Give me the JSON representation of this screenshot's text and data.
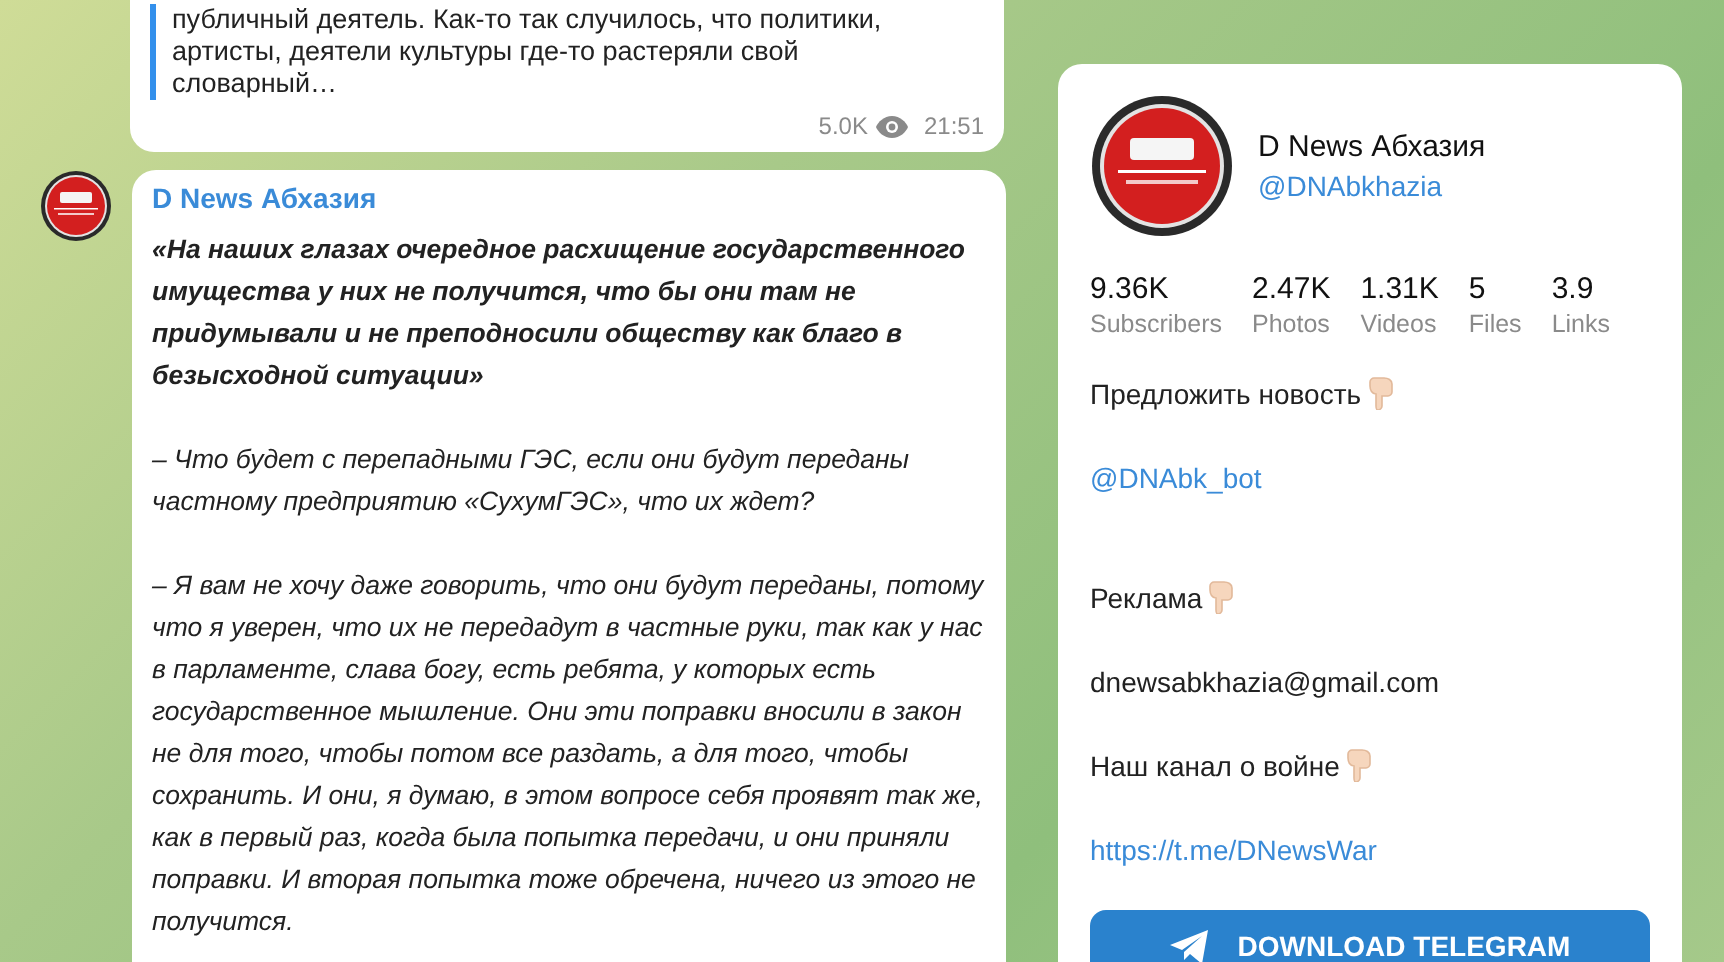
{
  "previous_post": {
    "quote_lines": "публичный деятель. Как-то так случилось, что политики, артисты, деятели культуры где-то растеряли свой словарный…",
    "views": "5.0K",
    "time": "21:51"
  },
  "post": {
    "author": "D News Абхазия",
    "paragraphs": [
      {
        "text": "«На наших глазах очередное расхищение государственного имущества у них не получится, что бы они там не придумывали и не преподносили обществу как благо в безысходной ситуации»",
        "bold": true
      },
      {
        "text": "– Что будет с перепадными ГЭС, если они будут переданы частному предприятию «СухумГЭС», что их ждет?",
        "bold": false
      },
      {
        "text": "– Я вам не хочу даже говорить, что они будут переданы, потому что я уверен, что их не передадут в частные руки, так как у нас в парламенте, слава богу, есть ребята, у которых есть государственное мышление. Они эти поправки вносили в закон не для того, чтобы потом все раздать, а для того, чтобы сохранить. И они, я думаю, в этом вопросе себя проявят так же, как в первый раз, когда была попытка передачи, и они приняли поправки. И вторая попытка тоже обречена, ничего из этого не получится.",
        "bold": false
      }
    ]
  },
  "channel": {
    "name": "D News Абхазия",
    "handle": "@DNAbkhazia",
    "stats": [
      {
        "value": "9.36K",
        "label": "Subscribers"
      },
      {
        "value": "2.47K",
        "label": "Photos"
      },
      {
        "value": "1.31K",
        "label": "Videos"
      },
      {
        "value": "5",
        "label": "Files"
      },
      {
        "value": "3.9",
        "label": "Links"
      }
    ],
    "description": [
      {
        "kind": "text",
        "text": "Предложить новость",
        "hand": true,
        "after_blank_line": false
      },
      {
        "kind": "link",
        "text": "@DNAbk_bot",
        "hand": false,
        "after_blank_line": false
      },
      {
        "kind": "text",
        "text": "Реклама",
        "hand": true,
        "after_blank_line": true
      },
      {
        "kind": "text",
        "text": "dnewsabkhazia@gmail.com",
        "hand": false,
        "after_blank_line": false
      },
      {
        "kind": "text",
        "text": "Наш канал о войне",
        "hand": true,
        "after_blank_line": false
      },
      {
        "kind": "link",
        "text": "https://t.me/DNewsWar",
        "hand": false,
        "after_blank_line": false
      }
    ],
    "download_button": "DOWNLOAD TELEGRAM"
  }
}
